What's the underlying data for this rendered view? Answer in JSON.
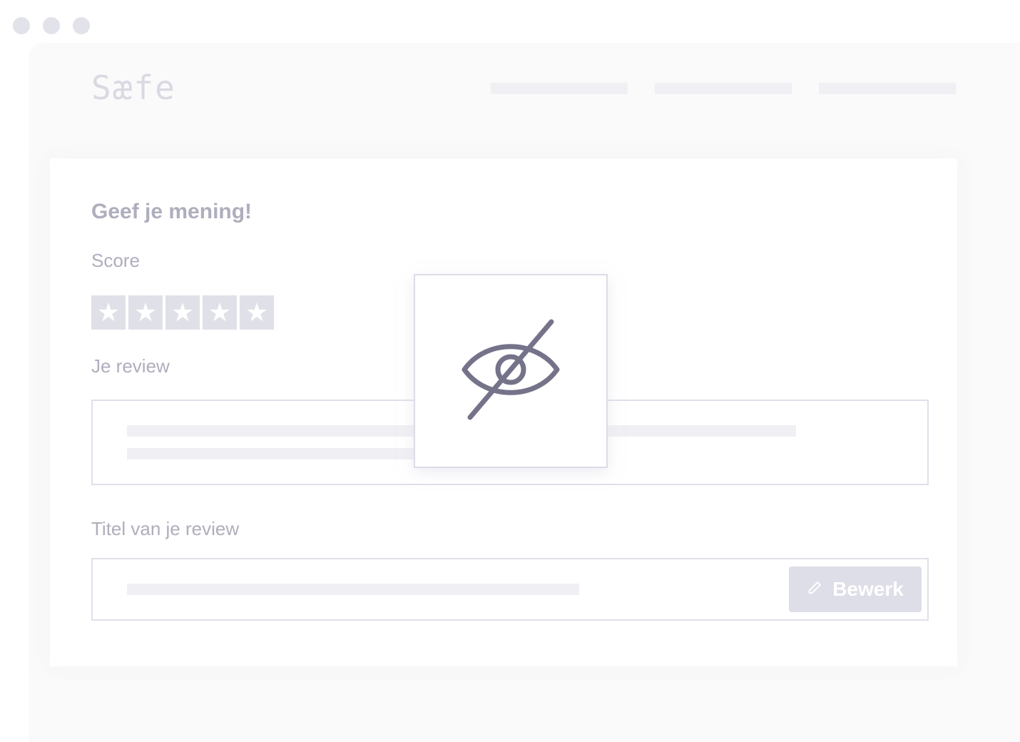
{
  "brand": {
    "logo_text": "Sæfe"
  },
  "form": {
    "heading": "Geef je mening!",
    "score_label": "Score",
    "stars": [
      "★",
      "★",
      "★",
      "★",
      "★"
    ],
    "review_label": "Je review",
    "title_label": "Titel van je review",
    "edit_button_label": "Bewerk"
  },
  "colors": {
    "accent_icon": "#74738a",
    "muted_text": "#aeaebd",
    "placeholder_bar": "#f0f0f4",
    "star_bg": "#e0e0e8"
  },
  "icons": {
    "overlay": "eye-slash-icon",
    "edit": "pencil-icon"
  }
}
